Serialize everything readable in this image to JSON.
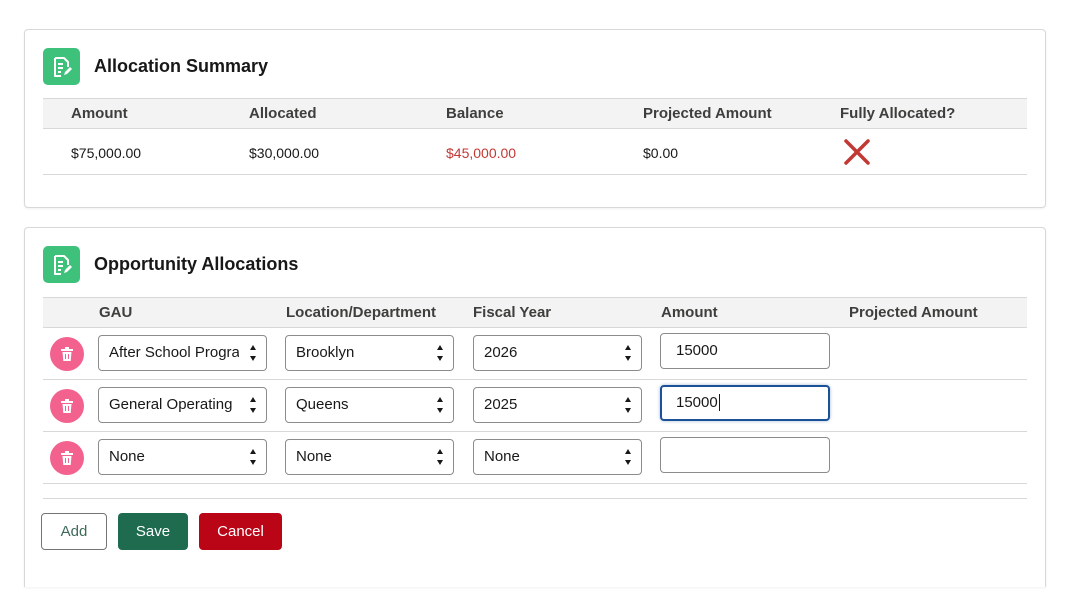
{
  "summary": {
    "title": "Allocation Summary",
    "icon": "document-edit-icon",
    "columns": [
      "Amount",
      "Allocated",
      "Balance",
      "Projected Amount",
      "Fully Allocated?"
    ],
    "values": {
      "amount": "$75,000.00",
      "allocated": "$30,000.00",
      "balance": "$45,000.00",
      "projected_amount": "$0.00",
      "fully_allocated_icon": "red-x-icon"
    },
    "balance_color": "#c23934"
  },
  "allocations": {
    "title": "Opportunity Allocations",
    "icon": "document-edit-icon",
    "columns": [
      "GAU",
      "Location/Department",
      "Fiscal Year",
      "Amount",
      "Projected Amount"
    ],
    "rows": [
      {
        "gau": "After School Progra",
        "location": "Brooklyn",
        "fiscal_year": "2026",
        "amount": "15000",
        "projected_amount": ""
      },
      {
        "gau": "General Operating",
        "location": "Queens",
        "fiscal_year": "2025",
        "amount": "15000",
        "projected_amount": ""
      },
      {
        "gau": "None",
        "location": "None",
        "fiscal_year": "None",
        "amount": "",
        "projected_amount": ""
      }
    ],
    "delete_icon": "trash-icon"
  },
  "actions": {
    "add_label": "Add",
    "save_label": "Save",
    "cancel_label": "Cancel"
  },
  "colors": {
    "icon_green": "#3ec17b",
    "delete_pink": "#f3628e",
    "save_green": "#1e6b4f",
    "cancel_red": "#ba0517",
    "focus_blue": "#1b5297"
  }
}
